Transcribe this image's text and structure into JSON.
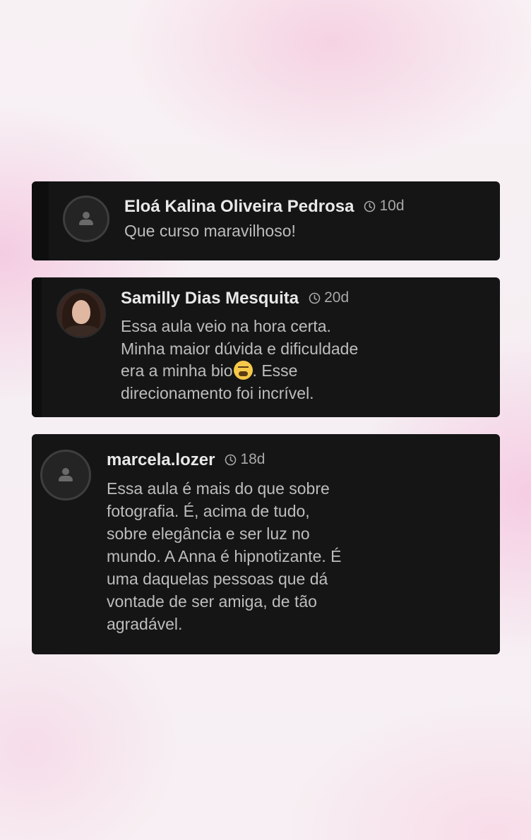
{
  "comments": [
    {
      "author": "Eloá Kalina Oliveira Pedrosa",
      "time": "10d",
      "avatar": "default-person-icon",
      "text": "Que curso maravilhoso!"
    },
    {
      "author": "Samilly Dias Mesquita",
      "time": "20d",
      "avatar": "profile-photo",
      "text_lines": [
        "Essa aula veio na hora certa.",
        "Minha maior dúvida e dificuldade",
        "era a minha bio",
        ". Esse",
        "direcionamento foi incrível."
      ],
      "emoji": "tired-face-emoji"
    },
    {
      "author": "marcela.lozer",
      "time": "18d",
      "avatar": "default-person-icon",
      "text": "Essa aula é mais do que sobre\nfotografia. É, acima de tudo,\nsobre elegância e ser luz no\nmundo. A Anna é hipnotizante. É\numa daquelas pessoas que dá\nvontade de ser amiga, de tão\nagradável."
    }
  ],
  "colors": {
    "card_bg": "#151515",
    "name_text": "#e9e9e9",
    "body_text": "#bdbdbd",
    "time_text": "#a8a8a8"
  }
}
